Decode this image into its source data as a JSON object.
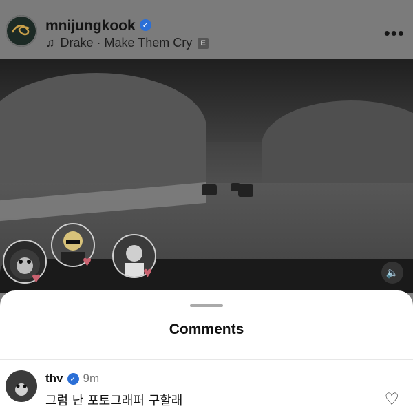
{
  "header": {
    "username": "mnijungkook",
    "verified_mark": "✓",
    "song": "Drake · Make Them Cry",
    "explicit_label": "E",
    "more_label": "•••"
  },
  "video": {
    "volume_icon": "speaker-icon"
  },
  "comments_sheet": {
    "title": "Comments",
    "comments": [
      {
        "user": "thv",
        "verified_mark": "✓",
        "time": "9m",
        "text": "그럼 난 포토그래퍼 구할래"
      }
    ]
  }
}
